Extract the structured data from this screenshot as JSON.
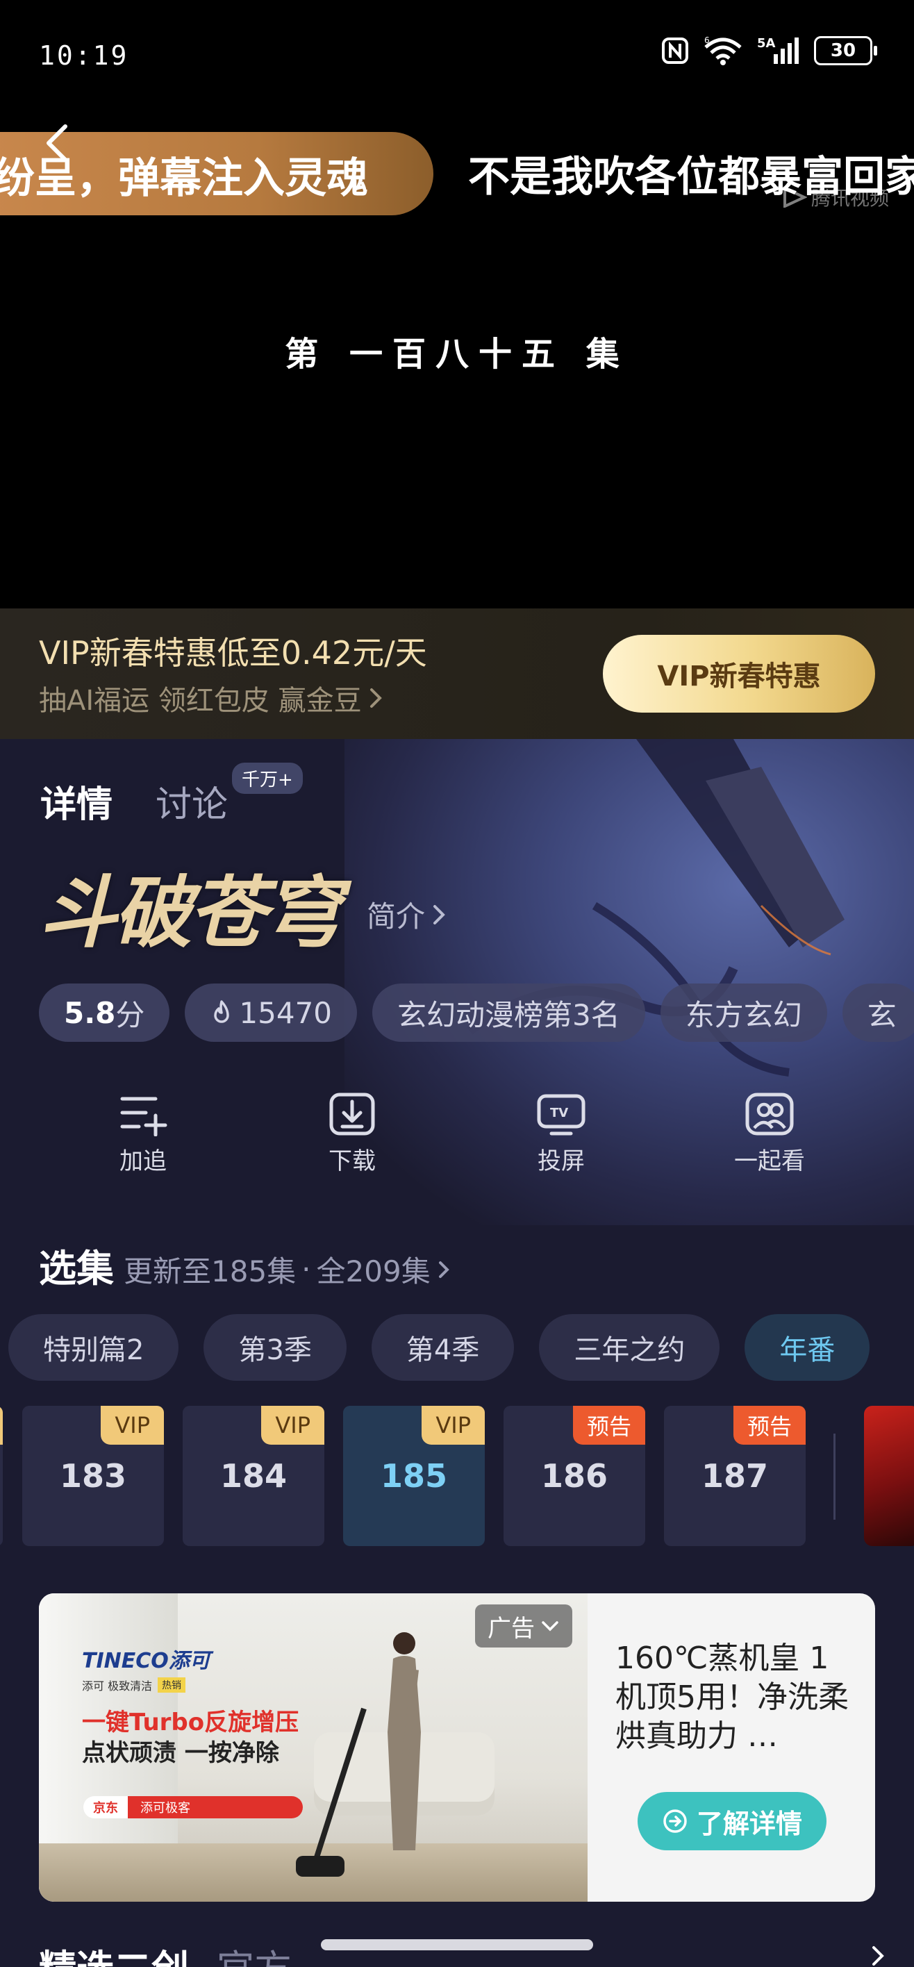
{
  "status_bar": {
    "time": "10:19",
    "battery": "30",
    "network": "5A"
  },
  "player": {
    "danmaku": [
      "纷呈，弹幕注入灵魂",
      "不是我吹各位都暴富回家"
    ],
    "watermark": "腾讯视频",
    "episode_title": "第 一百八十五 集"
  },
  "vip_banner": {
    "title": "VIP新春特惠低至0.42元/天",
    "subtitle": "抽AI福运 领红包皮 赢金豆",
    "button": "VIP新春特惠"
  },
  "details": {
    "tab_details": "详情",
    "tab_discussion": "讨论",
    "discussion_badge": "千万+",
    "show_logo": "斗破苍穹",
    "intro_link": "简介",
    "score_value": "5.8",
    "score_unit": "分",
    "heat": "15470",
    "tags": [
      "玄幻动漫榜第3名",
      "东方玄幻",
      "玄"
    ],
    "actions": [
      "加追",
      "下载",
      "投屏",
      "一起看"
    ]
  },
  "episodes": {
    "heading": "选集",
    "update_info": "更新至185集",
    "separator": "·",
    "total": "全209集",
    "seasons": [
      "特别篇2",
      "第3季",
      "第4季",
      "三年之约",
      "年番"
    ],
    "active_season": "年番",
    "items": [
      {
        "num": "183",
        "tag": "VIP"
      },
      {
        "num": "184",
        "tag": "VIP"
      },
      {
        "num": "185",
        "tag": "VIP",
        "current": true
      },
      {
        "num": "186",
        "tag": "预告"
      },
      {
        "num": "187",
        "tag": "预告"
      }
    ]
  },
  "ad": {
    "brand": "TINECO添可",
    "small_text": "添可 极致清洁",
    "small_highlight": "热销",
    "line1": "一键Turbo反旋增压",
    "line2": "点状顽渍 一按净除",
    "jd_left": "京东",
    "jd_right": "添可极客",
    "label": "广告",
    "text": "160℃蒸机皇 1机顶5用！净洗柔烘真助力 …",
    "button": "了解详情"
  },
  "more_section": {
    "title": "精选二创",
    "tab2": "官方"
  },
  "colors": {
    "background": "#1b1b30",
    "vip_gold": "#f2d88d",
    "accent_blue": "#6ec8f0",
    "preview_tag": "#ed5a2e",
    "ad_button": "#3dc2bf"
  }
}
